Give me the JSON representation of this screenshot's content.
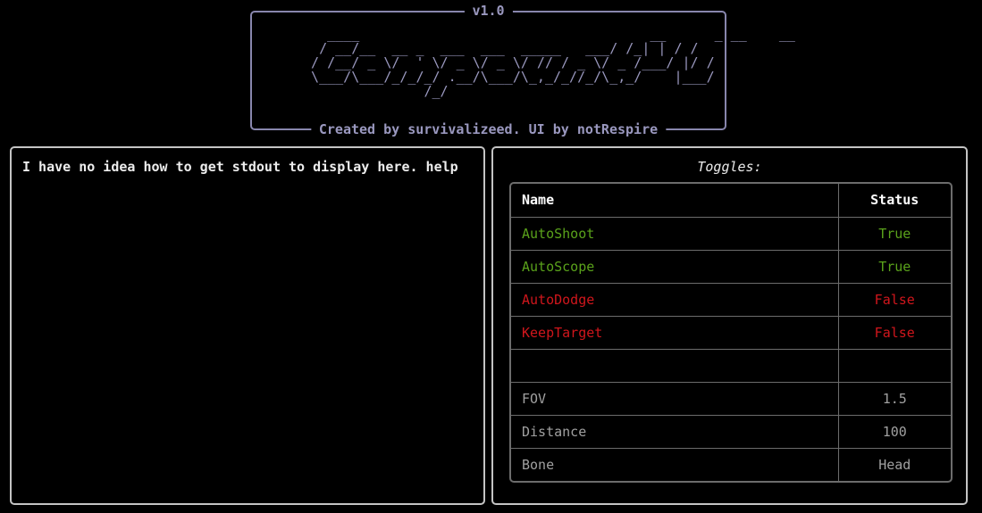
{
  "banner": {
    "version": "v1.0",
    "credits": "Created by survivalizeed. UI by notRespire",
    "ascii_art": "    ____                                    __      _ __    __\n   / __/__  __ _  ___  ___  _____   ___/ /_| | / /\n  / /__/ _ \\/  ' \\/ _ \\/ _ \\/ // / _ \\/ _ /___/ |/ /\n  \\___/\\___/_/_/_/ .__/\\___/\\_,_/_//_/\\_,_/    |___/\n                /_/"
  },
  "log": {
    "text": "I have no idea how to get stdout to display here. help"
  },
  "toggles": {
    "title": "Toggles:",
    "headers": {
      "name": "Name",
      "status": "Status"
    },
    "rows": [
      {
        "name": "AutoShoot",
        "status": "True",
        "color": "green"
      },
      {
        "name": "AutoScope",
        "status": "True",
        "color": "green"
      },
      {
        "name": "AutoDodge",
        "status": "False",
        "color": "red"
      },
      {
        "name": "KeepTarget",
        "status": "False",
        "color": "red"
      },
      {
        "name": "",
        "status": "",
        "color": "gray"
      },
      {
        "name": "FOV",
        "status": "1.5",
        "color": "gray"
      },
      {
        "name": "Distance",
        "status": "100",
        "color": "gray"
      },
      {
        "name": "Bone",
        "status": "Head",
        "color": "gray"
      }
    ]
  },
  "colors": {
    "green": "#5aa21b",
    "red": "#d0161c",
    "gray": "#a0a0a0",
    "accent": "#8886ad"
  }
}
